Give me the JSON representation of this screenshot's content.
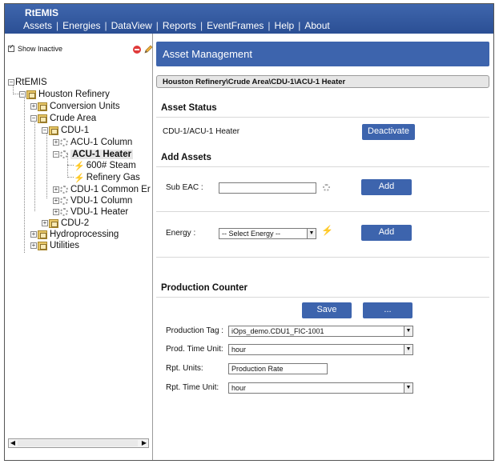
{
  "app": {
    "title": "RtEMIS"
  },
  "menu": [
    "Assets",
    "Energies",
    "DataView",
    "Reports",
    "EventFrames",
    "Help",
    "About"
  ],
  "sidebar": {
    "show_inactive": "Show Inactive",
    "tree": {
      "root": "RtEMIS",
      "houston": "Houston Refinery",
      "conversion": "Conversion Units",
      "crude": "Crude Area",
      "cdu1": "CDU-1",
      "acu1col": "ACU-1 Column",
      "acu1heater": "ACU-1 Heater",
      "steam": "600# Steam",
      "refgas": "Refinery Gas",
      "cdu1common": "CDU-1 Common Er",
      "vdu1col": "VDU-1 Column",
      "vdu1heater": "VDU-1 Heater",
      "cdu2": "CDU-2",
      "hydro": "Hydroprocessing",
      "utilities": "Utilities"
    }
  },
  "main": {
    "header": "Asset Management",
    "breadcrumb": "Houston Refinery\\Crude Area\\CDU-1\\ACU-1 Heater",
    "asset_status": {
      "title": "Asset Status",
      "path": "CDU-1/ACU-1 Heater",
      "deactivate": "Deactivate"
    },
    "add_assets": {
      "title": "Add Assets",
      "sub_eac_label": "Sub EAC :",
      "sub_eac_value": "",
      "add_label": "Add",
      "energy_label": "Energy :",
      "energy_select": "-- Select Energy --",
      "add2_label": "Add"
    },
    "production": {
      "title": "Production Counter",
      "save": "Save",
      "more": "...",
      "tag_label": "Production Tag :",
      "tag_value": "iOps_demo.CDU1_FIC-1001",
      "time_unit_label": "Prod. Time Unit:",
      "time_unit_value": "hour",
      "rpt_units_label": "Rpt. Units:",
      "rpt_units_value": "Production Rate",
      "rpt_time_label": "Rpt. Time Unit:",
      "rpt_time_value": "hour"
    }
  }
}
